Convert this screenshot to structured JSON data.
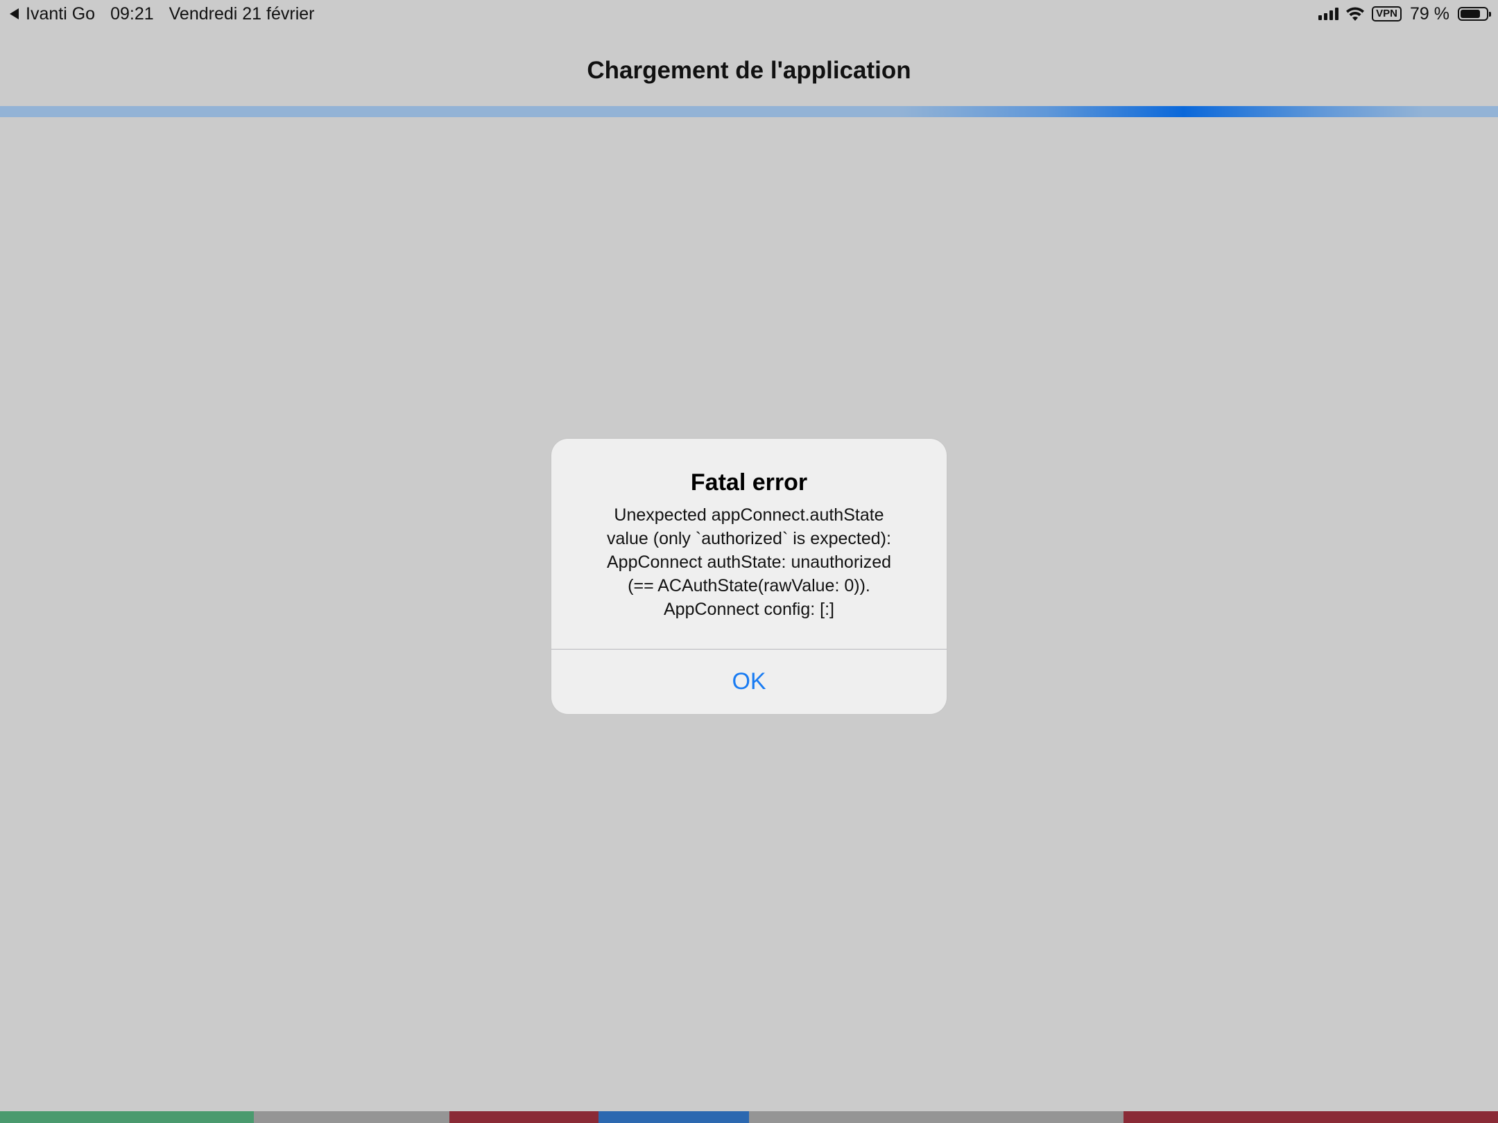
{
  "status_bar": {
    "back_app": "Ivanti Go",
    "time": "09:21",
    "date": "Vendredi 21 février",
    "vpn_label": "VPN",
    "battery_percent_text": "79 %",
    "battery_level": 0.79
  },
  "nav": {
    "title": "Chargement de l'application"
  },
  "alert": {
    "title": "Fatal error",
    "message": "Unexpected appConnect.authState\nvalue (only `authorized` is expected):\nAppConnect authState: unauthorized\n(== ACAuthState(rawValue: 0)).\nAppConnect config: [:]",
    "ok_label": "OK"
  },
  "colors": {
    "background": "#cbcbcb",
    "accent_blue": "#1a7cf2",
    "progress_light": "#93b3d6",
    "progress_dark": "#0a68da",
    "strip_green": "#4a9a6e",
    "strip_gray": "#959595",
    "strip_red": "#8a2a36",
    "strip_blue": "#2c68b0"
  }
}
